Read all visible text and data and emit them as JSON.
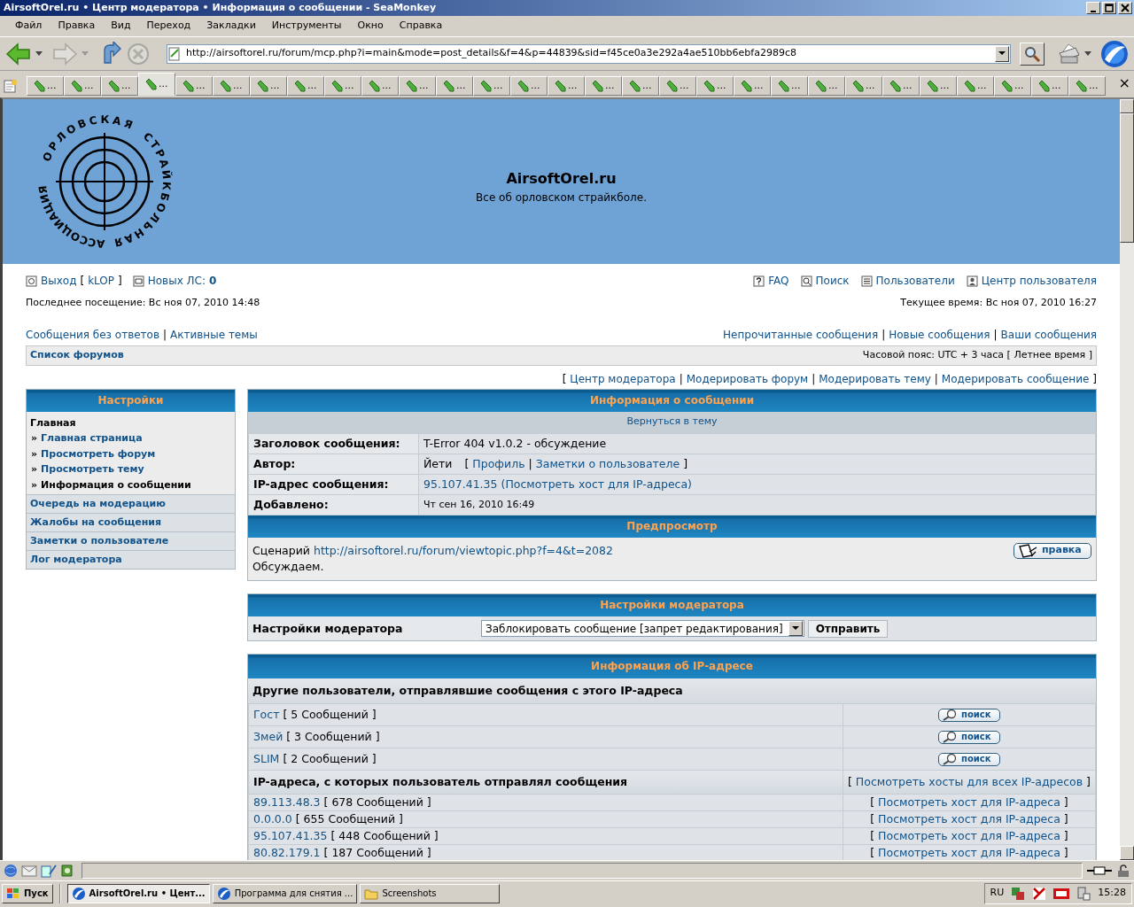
{
  "window": {
    "title": "AirsoftOrel.ru • Центр модератора • Информация о сообщении - SeaMonkey"
  },
  "menu": [
    "Файл",
    "Правка",
    "Вид",
    "Переход",
    "Закладки",
    "Инструменты",
    "Окно",
    "Справка"
  ],
  "address": {
    "url": "http://airsoftorel.ru/forum/mcp.php?i=main&mode=post_details&f=4&p=44839&sid=f45ce0a3e292a4ae510bb6ebfa2989c8"
  },
  "tabs": [
    {
      "label": "...",
      "selected": false
    },
    {
      "label": "...",
      "selected": false
    },
    {
      "label": "...",
      "selected": false
    },
    {
      "label": "...",
      "selected": true
    },
    {
      "label": "...",
      "selected": false
    },
    {
      "label": "...",
      "selected": false
    },
    {
      "label": "...",
      "selected": false
    },
    {
      "label": "...",
      "selected": false
    },
    {
      "label": "...",
      "selected": false
    },
    {
      "label": "...",
      "selected": false
    },
    {
      "label": "...",
      "selected": false
    },
    {
      "label": "...",
      "selected": false
    },
    {
      "label": "...",
      "selected": false
    },
    {
      "label": "...",
      "selected": false
    },
    {
      "label": "...",
      "selected": false
    },
    {
      "label": "...",
      "selected": false
    },
    {
      "label": "...",
      "selected": false
    },
    {
      "label": "...",
      "selected": false
    },
    {
      "label": "...",
      "selected": false
    },
    {
      "label": "...",
      "selected": false
    },
    {
      "label": "...",
      "selected": false
    },
    {
      "label": "...",
      "selected": false
    },
    {
      "label": "...",
      "selected": false
    },
    {
      "label": "...",
      "selected": false
    },
    {
      "label": "...",
      "selected": false
    },
    {
      "label": "...",
      "selected": false
    },
    {
      "label": "...",
      "selected": false
    },
    {
      "label": "...",
      "selected": false
    },
    {
      "label": "...",
      "selected": false
    }
  ],
  "tab_close": "×",
  "header": {
    "logo_words": [
      "ОРЛОВСКАЯ",
      "АССОЦИАЦИЯ",
      "СТРАЙКБОЛЬНАЯ"
    ],
    "site_title": "AirsoftOrel.ru",
    "site_description": "Все об орловском страйкболе."
  },
  "punct": {
    "open": "[",
    "close": "]",
    "sep": "|"
  },
  "userbar": {
    "logout": "Выход",
    "username": "kLOP",
    "pm_label": "Новых ЛС:",
    "pm_count": "0",
    "links": [
      {
        "kind": "faq",
        "label": "FAQ"
      },
      {
        "kind": "search",
        "label": "Поиск"
      },
      {
        "kind": "members",
        "label": "Пользователи"
      },
      {
        "kind": "ucp",
        "label": "Центр пользователя"
      }
    ]
  },
  "last_visit": "Последнее посещение: Вс ноя 07, 2010 14:48",
  "current_time": "Текущее время: Вс ноя 07, 2010 16:27",
  "quick_links_left": [
    "Сообщения без ответов",
    "Активные темы"
  ],
  "quick_links_right": [
    "Непрочитанные сообщения",
    "Новые сообщения",
    "Ваши сообщения"
  ],
  "breadcrumb": "Список форумов",
  "timezone": "Часовой пояс: UTC + 3 часа [ Летнее время ]",
  "mcp_links": [
    "Центр модератора",
    "Модерировать форум",
    "Модерировать тему",
    "Модерировать сообщение"
  ],
  "sidebar": {
    "title": "Настройки",
    "section": "Главная",
    "bullet": "»",
    "items": [
      {
        "label": "Главная страница",
        "selected": false
      },
      {
        "label": "Просмотреть форум",
        "selected": false
      },
      {
        "label": "Просмотреть тему",
        "selected": false
      },
      {
        "label": "Информация о сообщении",
        "selected": true
      }
    ],
    "links": [
      "Очередь на модерацию",
      "Жалобы на сообщения",
      "Заметки о пользователе",
      "Лог модератора"
    ]
  },
  "post_info": {
    "title": "Информация о сообщении",
    "back_link": "Вернуться в тему",
    "rows": [
      {
        "kind": "text",
        "label": "Заголовок сообщения:",
        "value": "T-Error 404 v1.0.2 - обсуждение"
      },
      {
        "kind": "author",
        "label": "Автор:",
        "value": "Йети",
        "links": [
          "Профиль",
          "Заметки о пользователе"
        ]
      },
      {
        "kind": "ip",
        "label": "IP-адрес сообщения:",
        "value": "95.107.41.35",
        "link": "(Посмотреть хост для IP-адреса)"
      },
      {
        "kind": "date",
        "label": "Добавлено:",
        "value": "Чт сен 16, 2010 16:49"
      }
    ]
  },
  "preview": {
    "title": "Предпросмотр",
    "prefix": "Сценарий",
    "link": "http://airsoftorel.ru/forum/viewtopic.php?f=4&t=2082",
    "line2": "Обсуждаем.",
    "edit_button": "правка"
  },
  "mod_options": {
    "title": "Настройки модератора",
    "label": "Настройки модератора",
    "select": "Заблокировать сообщение [запрет редактирования]",
    "submit": "Отправить"
  },
  "ip_info": {
    "title": "Информация об IP-адресе",
    "users_heading": "Другие пользователи, отправлявшие сообщения с этого IP-адреса",
    "users": [
      {
        "name": "Гост",
        "count": "[ 5 Сообщений ]",
        "button": "поиск"
      },
      {
        "name": "Змей",
        "count": "[ 3 Сообщений ]",
        "button": "поиск"
      },
      {
        "name": "SLIM",
        "count": "[ 2 Сообщений ]",
        "button": "поиск"
      }
    ],
    "ips_heading": "IP-адреса, с которых пользователь отправлял сообщения",
    "all_hosts": "Посмотреть хосты для всех IP-адресов",
    "ips": [
      {
        "ip": "89.113.48.3",
        "count": "[ 678 Сообщений ]",
        "link": "Посмотреть хост для IP-адреса"
      },
      {
        "ip": "0.0.0.0",
        "count": "[ 655 Сообщений ]",
        "link": "Посмотреть хост для IP-адреса"
      },
      {
        "ip": "95.107.41.35",
        "count": "[ 448 Сообщений ]",
        "link": "Посмотреть хост для IP-адреса"
      },
      {
        "ip": "80.82.179.1",
        "count": "[ 187 Сообщений ]",
        "link": "Посмотреть хост для IP-адреса"
      }
    ]
  },
  "taskbar": {
    "start": "Пуск",
    "tasks": [
      {
        "label": "AirsoftOrel.ru • Цент...",
        "selected": true
      },
      {
        "label": "Программа для снятия ...",
        "selected": false
      },
      {
        "label": "Screenshots",
        "selected": false
      }
    ],
    "language": "RU",
    "clock": "15:28"
  }
}
